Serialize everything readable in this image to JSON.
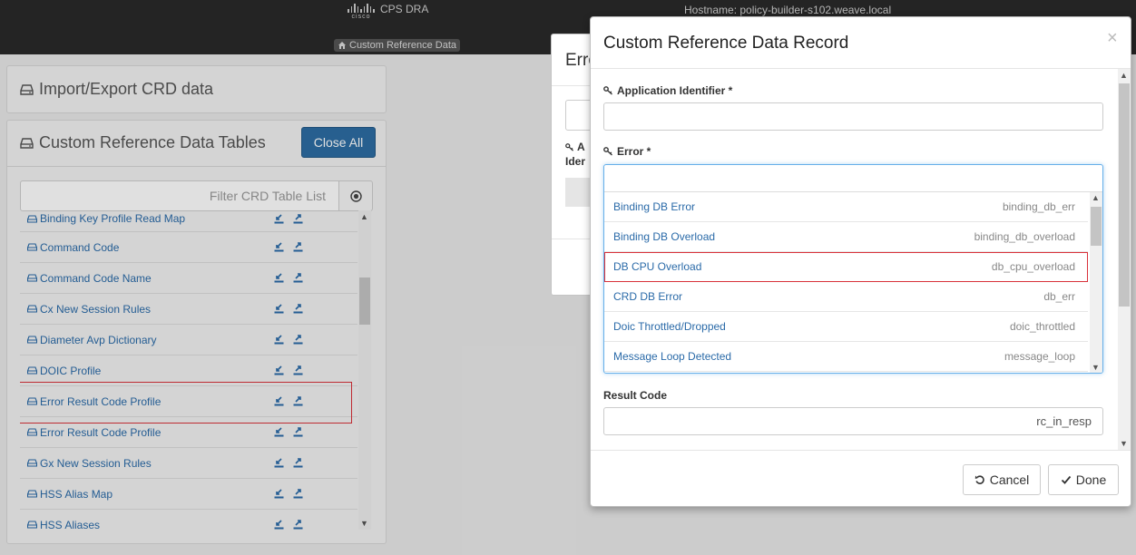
{
  "nav": {
    "logo_text": "cisco",
    "app_name": "CPS DRA",
    "hostname": "Hostname: policy-builder-s102.weave.local",
    "breadcrumb": "Custom Reference Data"
  },
  "left": {
    "import_title": "Import/Export CRD data",
    "tables_title": "Custom Reference Data Tables",
    "close_all": "Close All",
    "filter_placeholder": "Filter CRD Table List",
    "tables": [
      "Binding Key Profile Read Map",
      "Command Code",
      "Command Code Name",
      "Cx New Session Rules",
      "Diameter Avp Dictionary",
      "DOIC Profile",
      "Error Result Code Profile",
      "Error Result Code Profile",
      "Gx New Session Rules",
      "HSS Alias Map",
      "HSS Aliases"
    ]
  },
  "bg_modal": {
    "title": "Erro",
    "col_header_1": "A",
    "col_header_2": "Ider"
  },
  "modal": {
    "title": "Custom Reference Data Record",
    "close": "×",
    "app_id_label": "Application Identifier *",
    "error_label": "Error *",
    "result_code_label": "Result Code",
    "result_code_value": "rc_in_resp",
    "cancel": "Cancel",
    "done": "Done",
    "options": [
      {
        "name": "Binding DB Error",
        "value": "binding_db_err"
      },
      {
        "name": "Binding DB Overload",
        "value": "binding_db_overload"
      },
      {
        "name": "DB CPU Overload",
        "value": "db_cpu_overload"
      },
      {
        "name": "CRD DB Error",
        "value": "db_err"
      },
      {
        "name": "Doic Throttled/Dropped",
        "value": "doic_throttled"
      },
      {
        "name": "Message Loop Detected",
        "value": "message_loop"
      }
    ]
  },
  "colors": {
    "navbar": "#2a2a2a",
    "primary": "#2d6da3",
    "link": "#2a6aa8",
    "highlight": "#d9313a"
  }
}
